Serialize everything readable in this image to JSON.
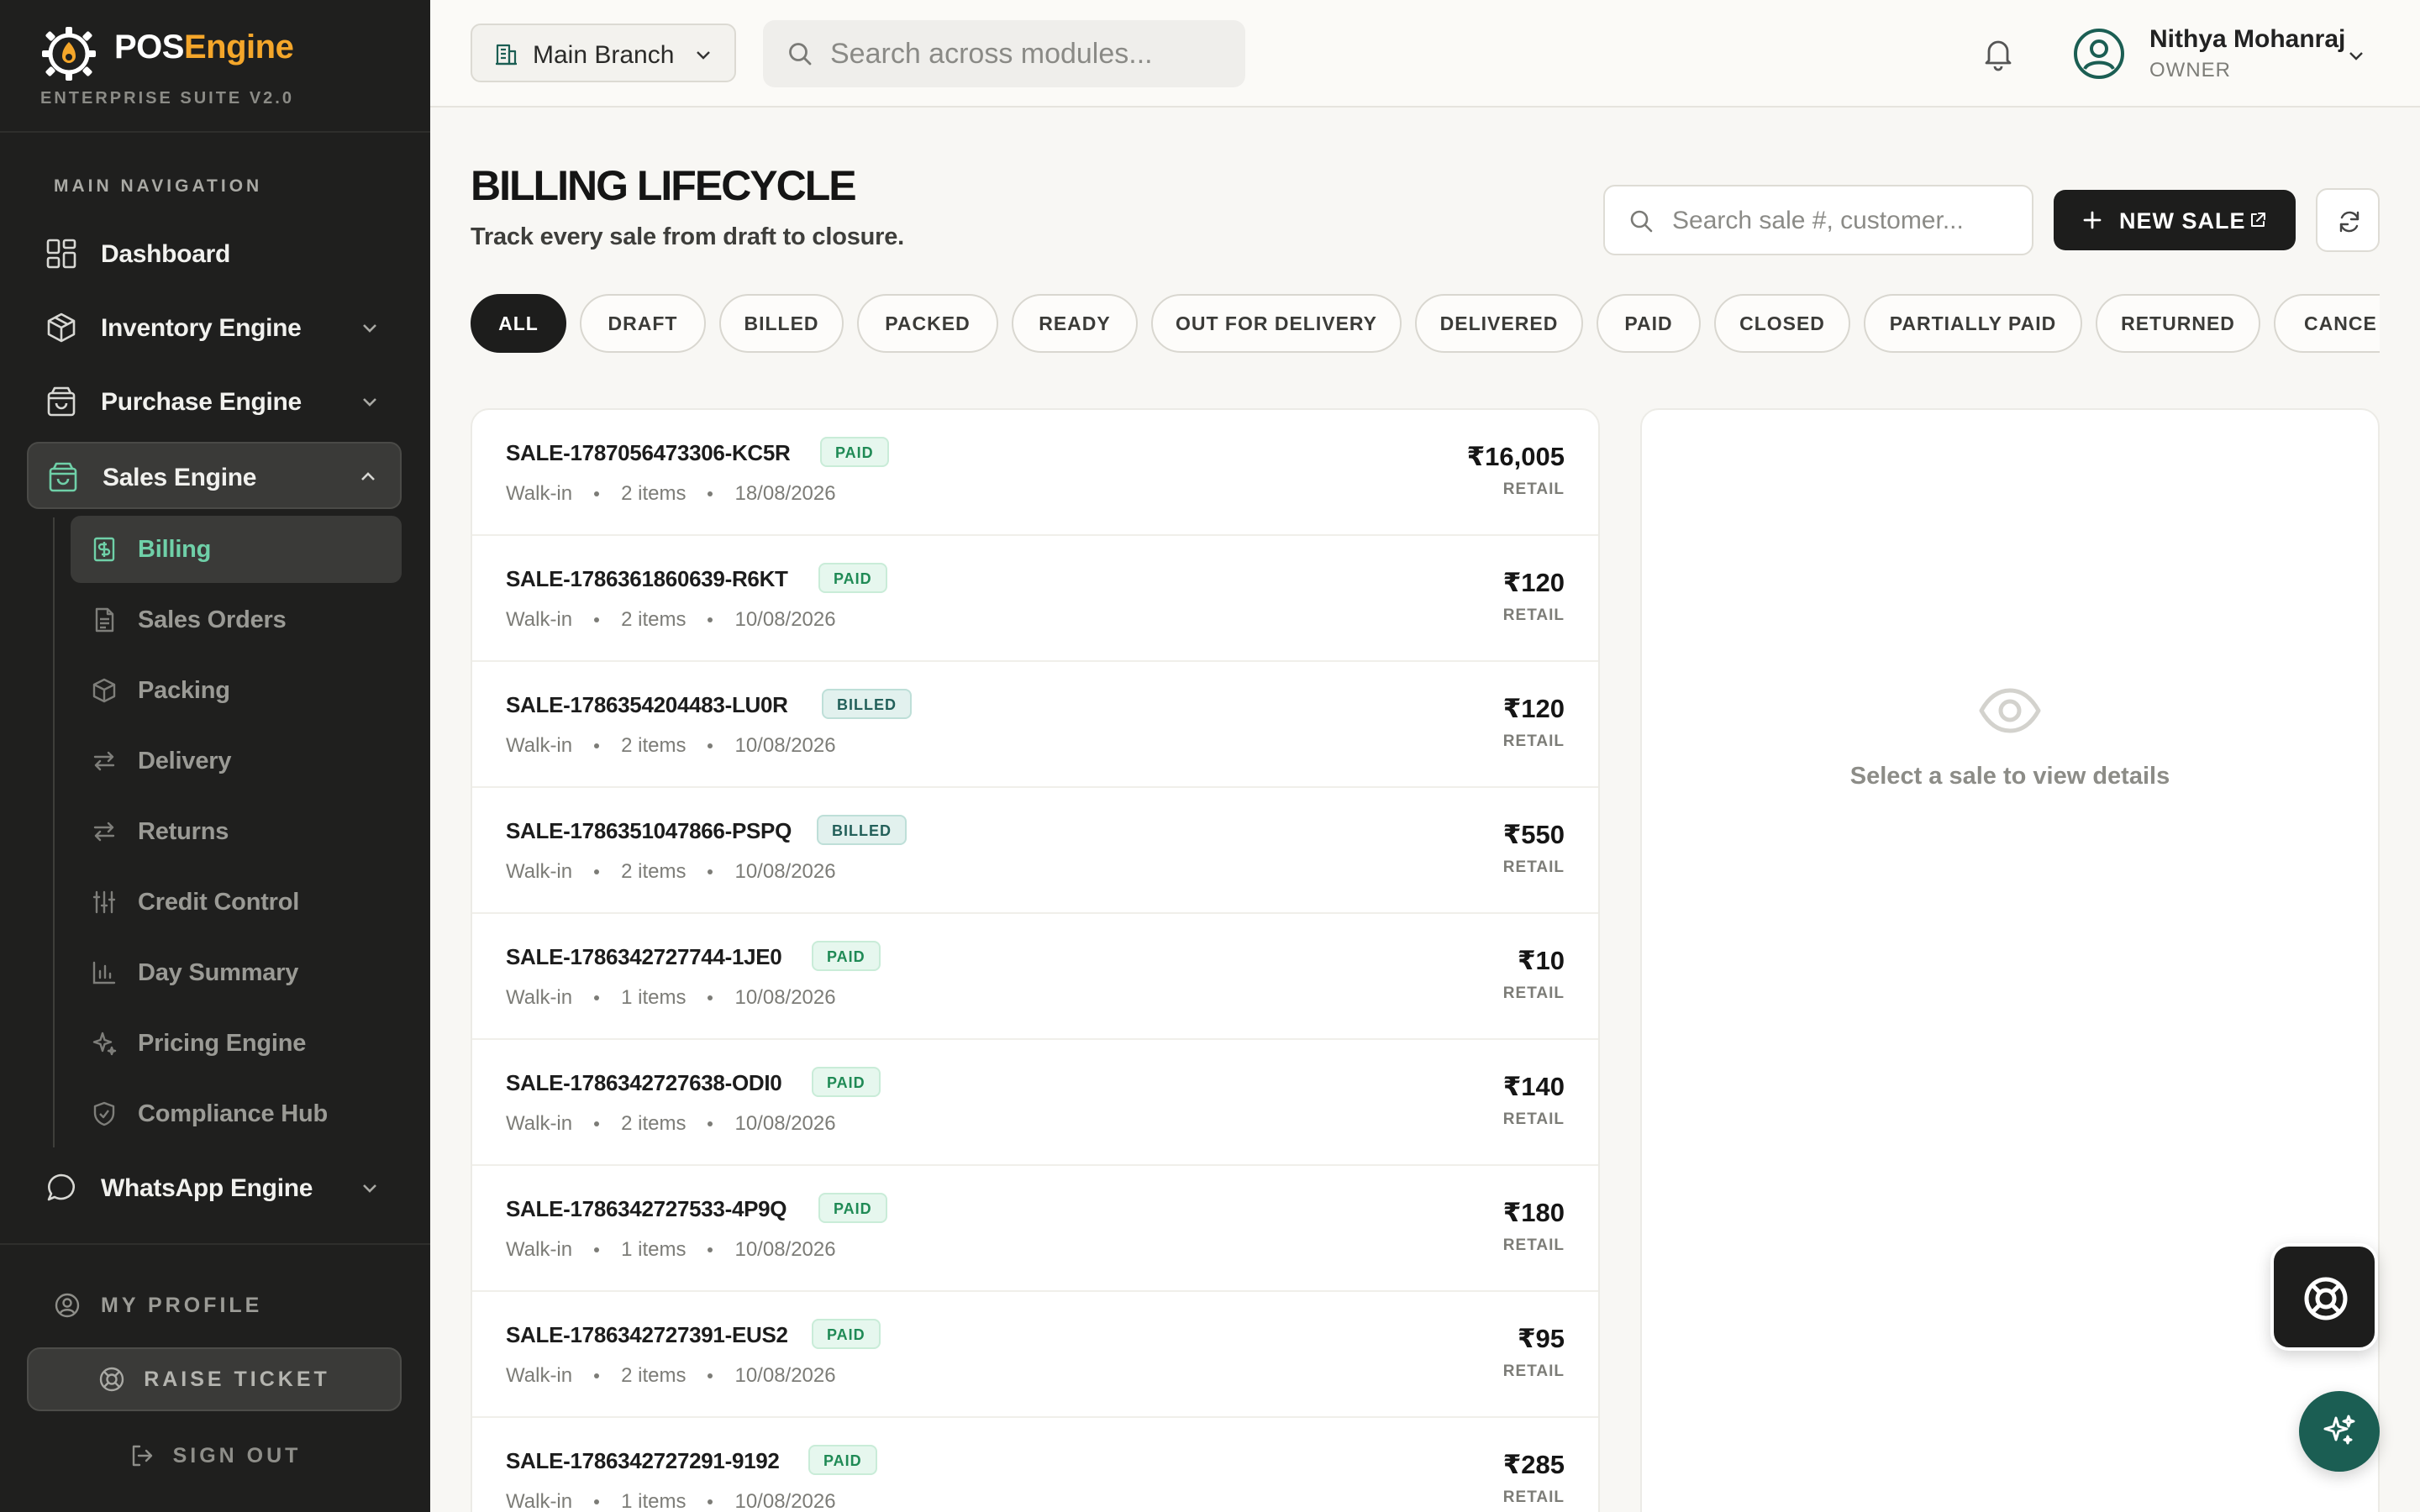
{
  "brand": {
    "name_part1": "POS",
    "name_part2": "Engine",
    "subtitle": "ENTERPRISE SUITE V2.0"
  },
  "sidebar": {
    "heading": "MAIN NAVIGATION",
    "items": [
      {
        "label": "Dashboard",
        "icon": "dashboard-icon"
      },
      {
        "label": "Inventory Engine",
        "icon": "box-icon"
      },
      {
        "label": "Purchase Engine",
        "icon": "shopping-bag-icon"
      },
      {
        "label": "Sales Engine",
        "icon": "shopping-bag-icon",
        "expanded": true
      },
      {
        "label": "WhatsApp Engine",
        "icon": "chat-bubble-icon"
      }
    ],
    "sales_subitems": [
      {
        "label": "Billing",
        "icon": "receipt-icon",
        "active": true
      },
      {
        "label": "Sales Orders",
        "icon": "document-icon"
      },
      {
        "label": "Packing",
        "icon": "box-icon"
      },
      {
        "label": "Delivery",
        "icon": "transfer-arrows-icon"
      },
      {
        "label": "Returns",
        "icon": "transfer-arrows-icon"
      },
      {
        "label": "Credit Control",
        "icon": "sliders-icon"
      },
      {
        "label": "Day Summary",
        "icon": "bar-chart-icon"
      },
      {
        "label": "Pricing Engine",
        "icon": "sparkle-icon"
      },
      {
        "label": "Compliance Hub",
        "icon": "shield-icon"
      }
    ],
    "profile_label": "MY PROFILE",
    "raise_ticket_label": "RAISE TICKET",
    "sign_out_label": "SIGN OUT"
  },
  "topbar": {
    "branch": "Main Branch",
    "search_placeholder": "Search across modules...",
    "user_name": "Nithya Mohanraj",
    "user_role": "OWNER"
  },
  "page": {
    "title": "BILLING LIFECYCLE",
    "subtitle": "Track every sale from draft to closure.",
    "search_placeholder": "Search sale #, customer...",
    "new_sale_label": "NEW SALE"
  },
  "filters": [
    "ALL",
    "DRAFT",
    "BILLED",
    "PACKED",
    "READY",
    "OUT FOR DELIVERY",
    "DELIVERED",
    "PAID",
    "CLOSED",
    "PARTIALLY PAID",
    "RETURNED",
    "CANCE"
  ],
  "sales": [
    {
      "id": "SALE-1787056473306-KC5R",
      "status": "PAID",
      "customer": "Walk-in",
      "items": "2 items",
      "date": "18/08/2026",
      "amount": "₹16,005",
      "type": "RETAIL"
    },
    {
      "id": "SALE-1786361860639-R6KT",
      "status": "PAID",
      "customer": "Walk-in",
      "items": "2 items",
      "date": "10/08/2026",
      "amount": "₹120",
      "type": "RETAIL"
    },
    {
      "id": "SALE-1786354204483-LU0R",
      "status": "BILLED",
      "customer": "Walk-in",
      "items": "2 items",
      "date": "10/08/2026",
      "amount": "₹120",
      "type": "RETAIL"
    },
    {
      "id": "SALE-1786351047866-PSPQ",
      "status": "BILLED",
      "customer": "Walk-in",
      "items": "2 items",
      "date": "10/08/2026",
      "amount": "₹550",
      "type": "RETAIL"
    },
    {
      "id": "SALE-1786342727744-1JE0",
      "status": "PAID",
      "customer": "Walk-in",
      "items": "1 items",
      "date": "10/08/2026",
      "amount": "₹10",
      "type": "RETAIL"
    },
    {
      "id": "SALE-1786342727638-ODI0",
      "status": "PAID",
      "customer": "Walk-in",
      "items": "2 items",
      "date": "10/08/2026",
      "amount": "₹140",
      "type": "RETAIL"
    },
    {
      "id": "SALE-1786342727533-4P9Q",
      "status": "PAID",
      "customer": "Walk-in",
      "items": "1 items",
      "date": "10/08/2026",
      "amount": "₹180",
      "type": "RETAIL"
    },
    {
      "id": "SALE-1786342727391-EUS2",
      "status": "PAID",
      "customer": "Walk-in",
      "items": "2 items",
      "date": "10/08/2026",
      "amount": "₹95",
      "type": "RETAIL"
    },
    {
      "id": "SALE-1786342727291-9192",
      "status": "PAID",
      "customer": "Walk-in",
      "items": "1 items",
      "date": "10/08/2026",
      "amount": "₹285",
      "type": "RETAIL"
    }
  ],
  "detail": {
    "empty_message": "Select a sale to view details"
  },
  "colors": {
    "accent_green": "#1b5e53",
    "brand_orange": "#f4a62a",
    "active_sub_green": "#6fd0a8"
  }
}
